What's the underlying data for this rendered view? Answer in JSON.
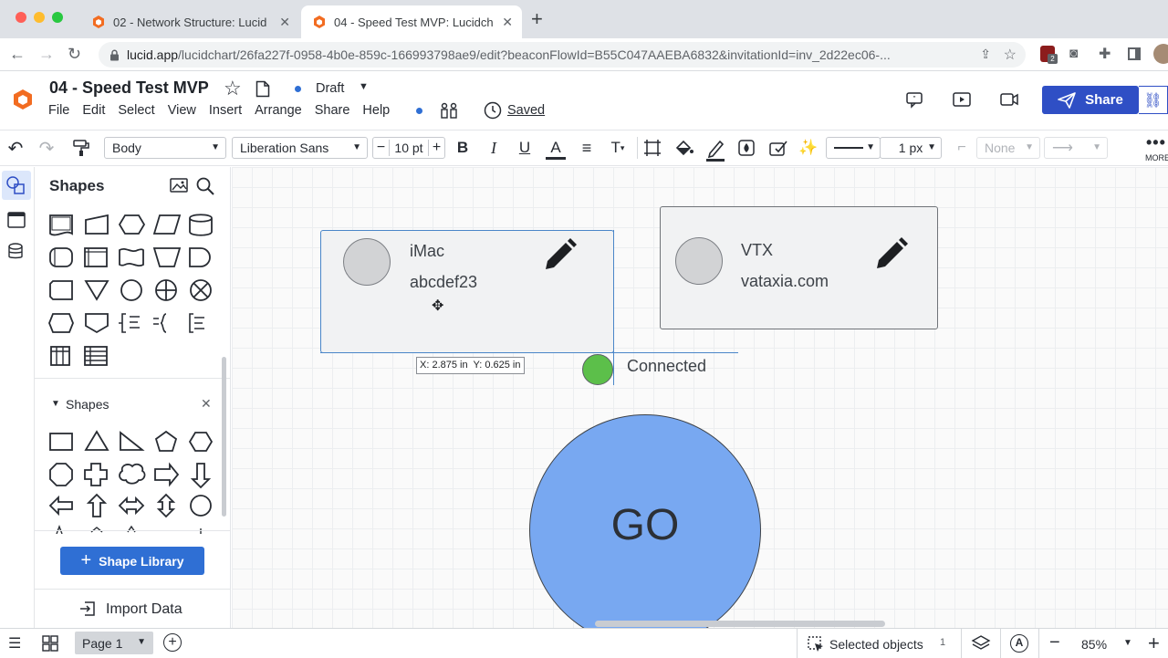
{
  "browser": {
    "tabs": [
      {
        "title": "02 - Network Structure: Lucid",
        "active": false
      },
      {
        "title": "04 - Speed Test MVP: Lucidch",
        "active": true
      }
    ],
    "url_host": "lucid.app",
    "url_path": "/lucidchart/26fa227f-0958-4b0e-859c-166993798ae9/edit?beaconFlowId=B55C047AAEBA6832&invitationId=inv_2d22ec06-...",
    "extension_badge": "2"
  },
  "app": {
    "doc_title": "04 - Speed Test MVP",
    "status": "Draft",
    "saved_label": "Saved",
    "menu": [
      "File",
      "Edit",
      "Select",
      "View",
      "Insert",
      "Arrange",
      "Share",
      "Help"
    ],
    "share_label": "Share",
    "accent_color": "#2f4fc5",
    "brand_color": "#f26c21"
  },
  "toolbar": {
    "style_select": "Body",
    "font_select": "Liberation Sans",
    "font_size": "10 pt",
    "line_width": "1 px",
    "endpoint_select": "None",
    "more_label": "MORE"
  },
  "panel": {
    "title": "Shapes",
    "section_label": "Shapes",
    "shape_library_button": "Shape Library",
    "import_label": "Import Data"
  },
  "canvas": {
    "card1": {
      "title": "iMac",
      "subtitle": "abcdef23"
    },
    "card2": {
      "title": "VTX",
      "subtitle": "vataxia.com"
    },
    "coord_tooltip": "X: 2.875 in  Y: 0.625 in",
    "status_label": "Connected",
    "status_color": "#5cbf4a",
    "go_label": "GO",
    "go_color": "#78a8f1"
  },
  "bottom": {
    "page_label": "Page 1",
    "selected_label": "Selected objects",
    "selected_count": "1",
    "zoom": "85%"
  }
}
